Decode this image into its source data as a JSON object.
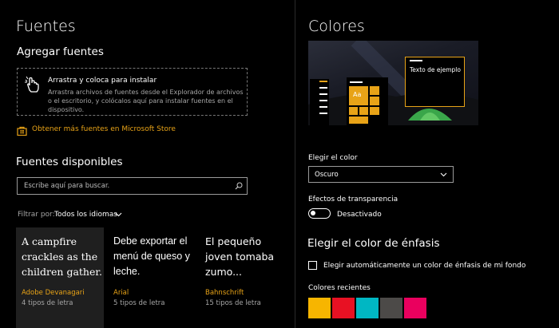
{
  "left": {
    "title": "Fuentes",
    "add_fonts_heading": "Agregar fuentes",
    "dropzone": {
      "title": "Arrastra y coloca para instalar",
      "description": "Arrastra archivos de fuentes desde el Explorador de archivos o el escritorio, y colócalos aquí para instalar fuentes en el dispositivo."
    },
    "store_link": "Obtener más fuentes en Microsoft Store",
    "available_heading": "Fuentes disponibles",
    "search_placeholder": "Escribe aquí para buscar.",
    "filter_label": "Filtrar por:",
    "filter_value": "Todos los idiomas",
    "fonts": [
      {
        "sample": "A campfire crackles as the children gather.",
        "name": "Adobe Devanagari",
        "count": "4 tipos de letra"
      },
      {
        "sample": "Debe exportar el menú de queso y leche.",
        "name": "Arial",
        "count": "5 tipos de letra"
      },
      {
        "sample": "El pequeño joven tomaba zumo...",
        "name": "Bahnschrift",
        "count": "15 tipos de letra"
      }
    ]
  },
  "right": {
    "title": "Colores",
    "preview_text": "Texto de ejemplo",
    "preview_tile": "Aa",
    "choose_color_label": "Elegir el color",
    "choose_color_value": "Oscuro",
    "transparency_label": "Efectos de transparencia",
    "transparency_value": "Desactivado",
    "accent_heading": "Elegir el color de énfasis",
    "auto_accent_label": "Elegir automáticamente un color de énfasis de mi fondo",
    "recent_colors_label": "Colores recientes",
    "recent_colors": [
      "#f7b500",
      "#e81123",
      "#00b7c3",
      "#4c4a48",
      "#ea005e"
    ]
  },
  "colors": {
    "accent": "#e8a317",
    "background": "#000000"
  }
}
